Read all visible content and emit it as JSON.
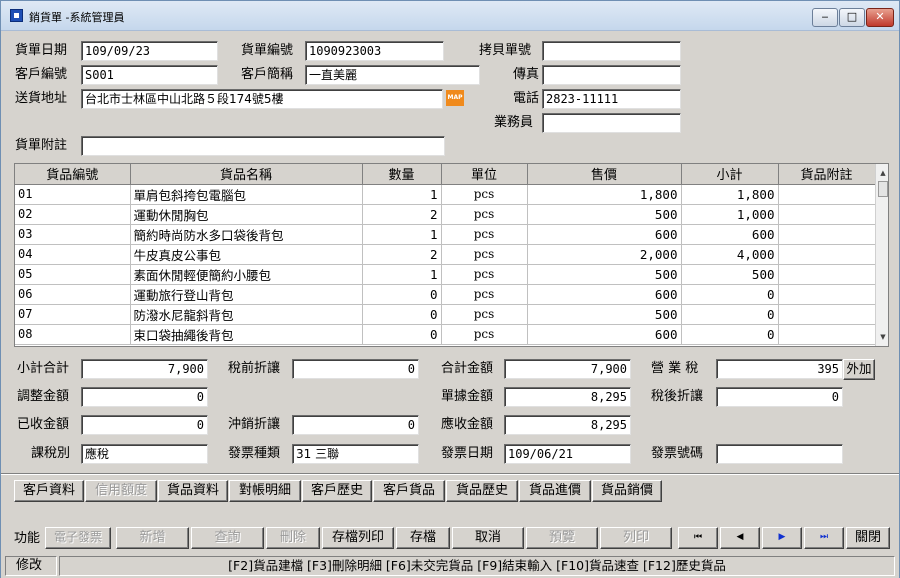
{
  "window": {
    "title": "銷貨單 -系統管理員",
    "min": "‒",
    "max": "□",
    "close": "✕"
  },
  "header": {
    "date_label": "貨單日期",
    "date_value": "109/09/23",
    "no_label": "貨單編號",
    "no_value": "1090923003",
    "copy_label": "拷貝單號",
    "copy_value": "",
    "cust_no_label": "客戶編號",
    "cust_no_value": "S001",
    "cust_name_label": "客戶簡稱",
    "cust_name_value": "一直美麗",
    "fax_label": "傳真",
    "fax_value": "",
    "addr_label": "送貨地址",
    "addr_value": "台北市士林區中山北路５段174號5樓",
    "map_icon_text": "MAP",
    "phone_label": "電話",
    "phone_value": "2823-11111",
    "sales_label": "業務員",
    "sales_value": "",
    "note_label": "貨單附註",
    "note_value": ""
  },
  "grid": {
    "columns": [
      "貨品編號",
      "貨品名稱",
      "數量",
      "單位",
      "售價",
      "小計",
      "貨品附註"
    ],
    "rows": [
      {
        "code": "01",
        "name": "單肩包斜挎包電腦包",
        "qty": "1",
        "unit": "pcs",
        "price": "1,800",
        "subtotal": "1,800",
        "note": ""
      },
      {
        "code": "02",
        "name": "運動休閒胸包",
        "qty": "2",
        "unit": "pcs",
        "price": "500",
        "subtotal": "1,000",
        "note": ""
      },
      {
        "code": "03",
        "name": "簡約時尚防水多口袋後背包",
        "qty": "1",
        "unit": "pcs",
        "price": "600",
        "subtotal": "600",
        "note": ""
      },
      {
        "code": "04",
        "name": "牛皮真皮公事包",
        "qty": "2",
        "unit": "pcs",
        "price": "2,000",
        "subtotal": "4,000",
        "note": ""
      },
      {
        "code": "05",
        "name": "素面休閒輕便簡約小腰包",
        "qty": "1",
        "unit": "pcs",
        "price": "500",
        "subtotal": "500",
        "note": ""
      },
      {
        "code": "06",
        "name": "運動旅行登山背包",
        "qty": "0",
        "unit": "pcs",
        "price": "600",
        "subtotal": "0",
        "note": ""
      },
      {
        "code": "07",
        "name": "防潑水尼龍斜背包",
        "qty": "0",
        "unit": "pcs",
        "price": "500",
        "subtotal": "0",
        "note": ""
      },
      {
        "code": "08",
        "name": "束口袋抽繩後背包",
        "qty": "0",
        "unit": "pcs",
        "price": "600",
        "subtotal": "0",
        "note": ""
      }
    ]
  },
  "totals": {
    "subtotal_label": "小計合計",
    "subtotal_value": "7,900",
    "pretax_disc_label": "稅前折讓",
    "pretax_disc_value": "0",
    "total_label": "合計金額",
    "total_value": "7,900",
    "tax_label": "營 業 稅",
    "tax_value": "395",
    "tax_mode": "外加",
    "adjust_label": "調整金額",
    "adjust_value": "0",
    "bill_label": "單據金額",
    "bill_value": "8,295",
    "posttax_disc_label": "稅後折讓",
    "posttax_disc_value": "0",
    "received_label": "已收金額",
    "received_value": "0",
    "offset_disc_label": "沖銷折讓",
    "offset_disc_value": "0",
    "receivable_label": "應收金額",
    "receivable_value": "8,295",
    "tax_type_label": "課稅別",
    "tax_type_value": "應稅",
    "invoice_type_label": "發票種類",
    "invoice_type_value": "31 三聯",
    "invoice_date_label": "發票日期",
    "invoice_date_value": "109/06/21",
    "invoice_no_label": "發票號碼",
    "invoice_no_value": ""
  },
  "tabs": [
    "客戶資料",
    "信用額度",
    "貨品資料",
    "對帳明細",
    "客戶歷史",
    "客戶貨品",
    "貨品歷史",
    "貨品進價",
    "貨品銷價"
  ],
  "toolbar": {
    "func_label": "功能",
    "einvoice": "電子發票",
    "add": "新增",
    "query": "查詢",
    "delete": "刪除",
    "save_print": "存檔列印",
    "save": "存檔",
    "cancel": "取消",
    "preview": "預覽",
    "print": "列印",
    "first": "⏮",
    "prev": "◀",
    "next": "▶",
    "last": "⏭",
    "close": "關閉"
  },
  "status": {
    "mode": "修改",
    "keys": "[F2]貨品建檔 [F3]刪除明細 [F6]未交完貨品 [F9]結束輸入 [F10]貨品速查 [F12]歷史貨品"
  }
}
